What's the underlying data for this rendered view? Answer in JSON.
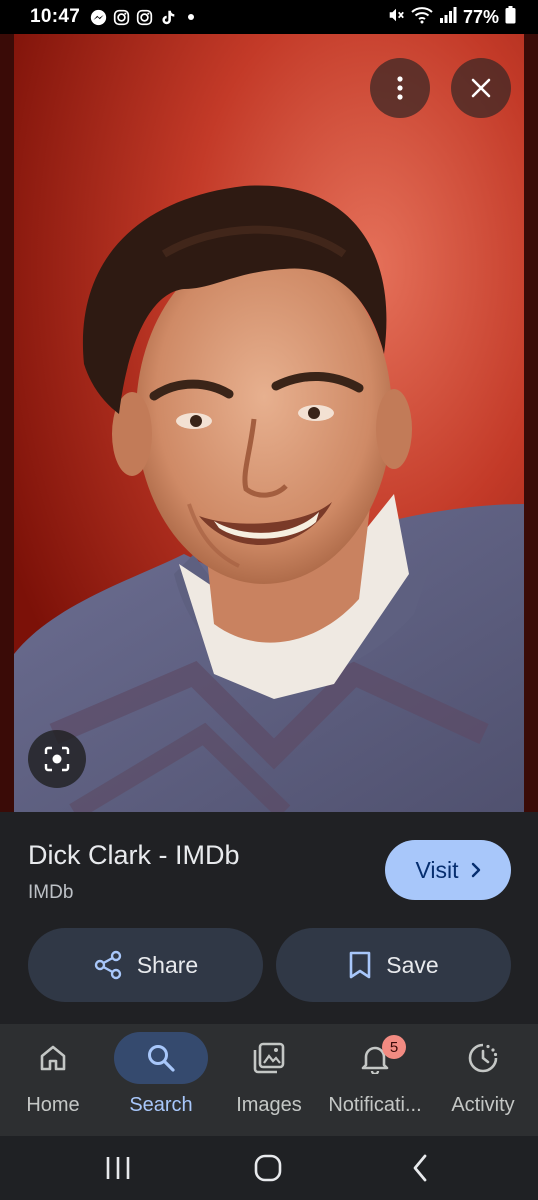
{
  "status_bar": {
    "time": "10:47",
    "battery": "77%",
    "app_icons": [
      "messenger-icon",
      "instagram-icon",
      "instagram-icon",
      "tiktok-icon",
      "dot-icon"
    ],
    "system_icons": [
      "mute-icon",
      "wifi-icon",
      "signal-icon",
      "battery-icon"
    ]
  },
  "viewer": {
    "more_options_icon": "more-vert-icon",
    "close_icon": "close-icon",
    "lens_icon": "lens-icon"
  },
  "result": {
    "title": "Dick Clark - IMDb",
    "source": "IMDb",
    "visit_label": "Visit",
    "share_label": "Share",
    "save_label": "Save"
  },
  "bottom_nav": {
    "items": [
      {
        "label": "Home",
        "icon": "home-icon"
      },
      {
        "label": "Search",
        "icon": "search-icon",
        "active": true
      },
      {
        "label": "Images",
        "icon": "images-icon"
      },
      {
        "label": "Notificati...",
        "icon": "bell-icon",
        "badge": "5"
      },
      {
        "label": "Activity",
        "icon": "activity-icon"
      }
    ]
  },
  "colors": {
    "accent": "#a8c7fa",
    "panel": "#202124",
    "nav": "#2d2f31",
    "badge": "#f28b82"
  }
}
